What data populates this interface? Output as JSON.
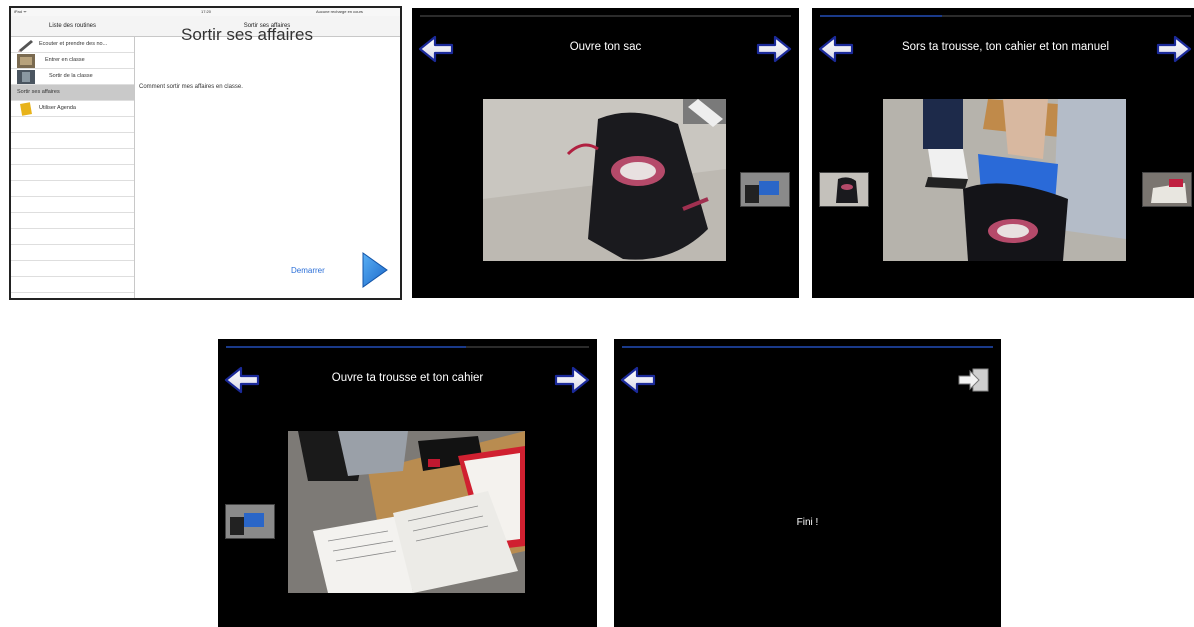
{
  "ipad": {
    "status_left": "iPad ᯤ",
    "status_time": "17:20",
    "status_right": "Aucune recharge en cours",
    "sidebar_title": "Liste des routines",
    "detail_nav_title": "Sortir ses affaires",
    "items": [
      {
        "label": "Ecouter et prendre des no..."
      },
      {
        "label": "Entrer en classe"
      },
      {
        "label": "Sortir de la classe"
      },
      {
        "label": "Sortir ses affaires"
      },
      {
        "label": "Utiliser Agenda"
      }
    ],
    "detail_title": "Sortir ses affaires",
    "detail_subtitle": "Comment sortir mes affaires en classe.",
    "start_label": "Demarrer"
  },
  "slides": [
    {
      "title": "Ouvre ton sac",
      "progress": 0.0
    },
    {
      "title": "Sors ta trousse, ton cahier et ton manuel",
      "progress": 0.33
    },
    {
      "title": "Ouvre ta trousse et ton cahier",
      "progress": 0.66
    },
    {
      "title": "",
      "progress": 1.0,
      "end_text": "Fini !"
    }
  ],
  "colors": {
    "progress_fill": "#1a3a8a",
    "accent_blue": "#2b6fd8"
  },
  "icons": [
    "back-arrow-icon",
    "forward-arrow-icon",
    "exit-icon",
    "play-icon",
    "pencil-icon"
  ]
}
